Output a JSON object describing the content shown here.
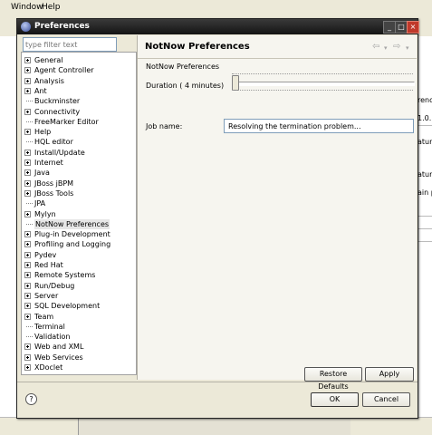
{
  "background": {
    "menus": [
      "Window",
      "Help"
    ],
    "right_fragments": [
      "reno",
      "1.0.",
      "ature",
      "ature",
      "ain pl"
    ]
  },
  "dialog": {
    "title": "Preferences",
    "filter_placeholder": "type filter text",
    "tree": [
      {
        "label": "General",
        "expandable": true
      },
      {
        "label": "Agent Controller",
        "expandable": true
      },
      {
        "label": "Analysis",
        "expandable": true
      },
      {
        "label": "Ant",
        "expandable": true
      },
      {
        "label": "Buckminster",
        "expandable": false
      },
      {
        "label": "Connectivity",
        "expandable": true
      },
      {
        "label": "FreeMarker Editor",
        "expandable": false
      },
      {
        "label": "Help",
        "expandable": true
      },
      {
        "label": "HQL editor",
        "expandable": false
      },
      {
        "label": "Install/Update",
        "expandable": true
      },
      {
        "label": "Internet",
        "expandable": true
      },
      {
        "label": "Java",
        "expandable": true
      },
      {
        "label": "JBoss jBPM",
        "expandable": true
      },
      {
        "label": "JBoss Tools",
        "expandable": true
      },
      {
        "label": "JPA",
        "expandable": false
      },
      {
        "label": "Mylyn",
        "expandable": true
      },
      {
        "label": "NotNow Preferences",
        "expandable": false,
        "selected": true
      },
      {
        "label": "Plug-in Development",
        "expandable": true
      },
      {
        "label": "Profiling and Logging",
        "expandable": true
      },
      {
        "label": "Pydev",
        "expandable": true
      },
      {
        "label": "Red Hat",
        "expandable": true
      },
      {
        "label": "Remote Systems",
        "expandable": true
      },
      {
        "label": "Run/Debug",
        "expandable": true
      },
      {
        "label": "Server",
        "expandable": true
      },
      {
        "label": "SQL Development",
        "expandable": true
      },
      {
        "label": "Team",
        "expandable": true
      },
      {
        "label": "Terminal",
        "expandable": false
      },
      {
        "label": "Validation",
        "expandable": false
      },
      {
        "label": "Web and XML",
        "expandable": true
      },
      {
        "label": "Web Services",
        "expandable": true
      },
      {
        "label": "XDoclet",
        "expandable": true
      }
    ],
    "page": {
      "title": "NotNow Preferences",
      "description": "NotNow Preferences",
      "duration_label": "Duration ( 4 minutes)",
      "duration_level": 0.0,
      "job_label": "Job name:",
      "job_value": "Resolving the termination problem..."
    },
    "buttons": {
      "restore_defaults": "Restore Defaults",
      "apply": "Apply",
      "ok": "OK",
      "cancel": "Cancel",
      "help": "?"
    }
  }
}
